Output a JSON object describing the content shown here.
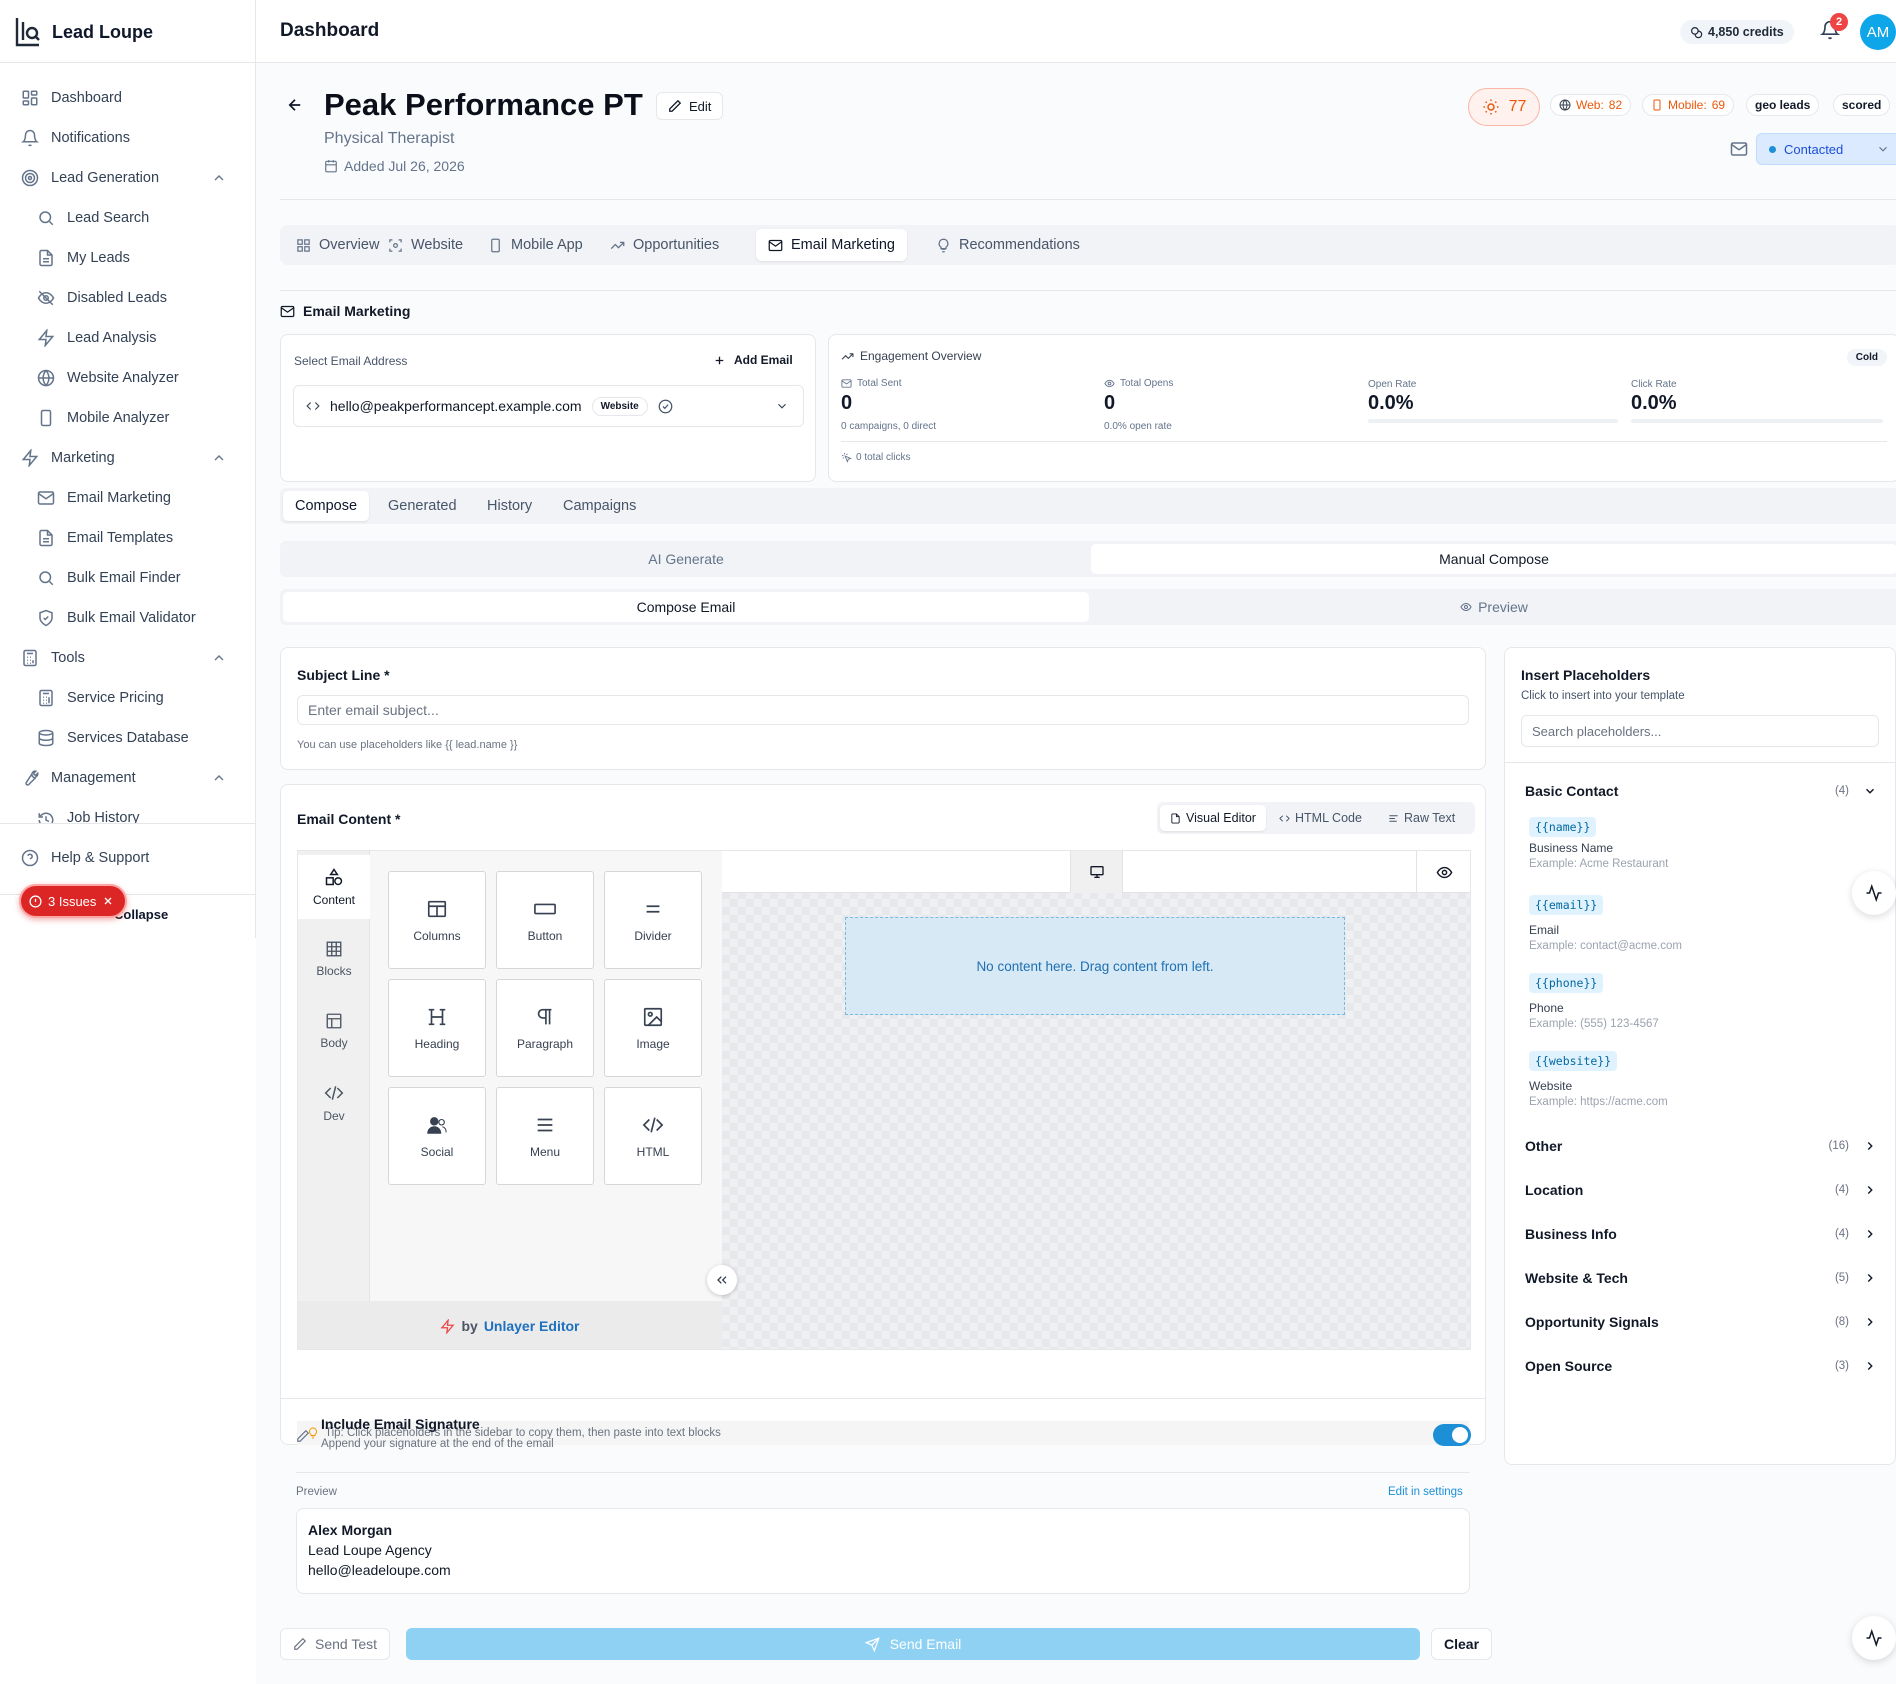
{
  "brand": {
    "name": "Lead Loupe"
  },
  "sidebar": {
    "items": [
      {
        "label": "Dashboard",
        "icon": "grid-icon"
      },
      {
        "label": "Notifications",
        "icon": "bell-icon"
      },
      {
        "label": "Lead Generation",
        "icon": "target-icon",
        "expanded": true
      },
      {
        "label": "Lead Search",
        "icon": "search-icon"
      },
      {
        "label": "My Leads",
        "icon": "file-icon"
      },
      {
        "label": "Disabled Leads",
        "icon": "eye-off-icon"
      },
      {
        "label": "Lead Analysis",
        "icon": "bolt-icon"
      },
      {
        "label": "Website Analyzer",
        "icon": "globe-icon"
      },
      {
        "label": "Mobile Analyzer",
        "icon": "phone-icon"
      },
      {
        "label": "Marketing",
        "icon": "bolt-icon",
        "expanded": true
      },
      {
        "label": "Email Marketing",
        "icon": "mail-icon"
      },
      {
        "label": "Email Templates",
        "icon": "file-icon"
      },
      {
        "label": "Bulk Email Finder",
        "icon": "search-icon"
      },
      {
        "label": "Bulk Email Validator",
        "icon": "shield-icon"
      },
      {
        "label": "Tools",
        "icon": "calculator-icon",
        "expanded": true
      },
      {
        "label": "Service Pricing",
        "icon": "calculator-icon"
      },
      {
        "label": "Services Database",
        "icon": "database-icon"
      },
      {
        "label": "Management",
        "icon": "wrench-icon",
        "expanded": true
      },
      {
        "label": "Job History",
        "icon": "history-icon"
      }
    ],
    "help": "Help & Support",
    "issues": "3 Issues",
    "collapse": "Collapse"
  },
  "header": {
    "title": "Dashboard",
    "credits": "4,850 credits",
    "notif_count": "2",
    "avatar": "AM"
  },
  "lead": {
    "name": "Peak Performance PT",
    "edit": "Edit",
    "category": "Physical Therapist",
    "added": "Added Jul 26, 2026",
    "score": "77",
    "web_label": "Web:",
    "web_score": "82",
    "mobile_label": "Mobile:",
    "mobile_score": "69",
    "tag1": "geo leads",
    "tag2": "scored",
    "status": "Contacted",
    "colors": {
      "accent": "#1d8fd6",
      "score": "#ea580c",
      "danger": "#dc2626"
    }
  },
  "tabs": [
    "Overview",
    "Website",
    "Mobile App",
    "Opportunities",
    "Email Marketing",
    "Recommendations"
  ],
  "email": {
    "section_title": "Email Marketing",
    "select_label": "Select Email Address",
    "add_email": "Add Email",
    "address": "hello@peakperformancept.example.com",
    "source": "Website"
  },
  "engagement": {
    "title": "Engagement Overview",
    "badge": "Cold",
    "total_sent_label": "Total Sent",
    "total_sent": "0",
    "total_sent_sub": "0 campaigns, 0 direct",
    "total_opens_label": "Total Opens",
    "total_opens": "0",
    "total_opens_sub": "0.0% open rate",
    "open_rate_label": "Open Rate",
    "open_rate": "0.0%",
    "click_rate_label": "Click Rate",
    "click_rate": "0.0%",
    "clicks": "0 total clicks"
  },
  "subtabs": [
    "Compose",
    "Generated",
    "History",
    "Campaigns"
  ],
  "mode": {
    "ai": "AI Generate",
    "manual": "Manual Compose"
  },
  "view": {
    "compose": "Compose Email",
    "preview": "Preview"
  },
  "subject": {
    "label": "Subject Line *",
    "placeholder": "Enter email subject...",
    "hint": "You can use placeholders like {{ lead.name }}"
  },
  "content": {
    "label": "Email Content *",
    "modes": [
      "Visual Editor",
      "HTML Code",
      "Raw Text"
    ],
    "side": [
      "Content",
      "Blocks",
      "Body",
      "Dev"
    ],
    "tiles": [
      "Columns",
      "Button",
      "Divider",
      "Heading",
      "Paragraph",
      "Image",
      "Social",
      "Menu",
      "HTML"
    ],
    "by": "by",
    "editor_brand": "Unlayer Editor",
    "drop": "No content here. Drag content from left.",
    "tip": "Tip: Click placeholders in the sidebar to copy them, then paste into text blocks"
  },
  "placeholders": {
    "title": "Insert Placeholders",
    "subtitle": "Click to insert into your template",
    "search_placeholder": "Search placeholders...",
    "basic": {
      "name": "Basic Contact",
      "count": "(4)"
    },
    "items": [
      {
        "code": "{{name}}",
        "label": "Business Name",
        "example": "Example: Acme Restaurant"
      },
      {
        "code": "{{email}}",
        "label": "Email",
        "example": "Example: contact@acme.com"
      },
      {
        "code": "{{phone}}",
        "label": "Phone",
        "example": "Example: (555) 123-4567"
      },
      {
        "code": "{{website}}",
        "label": "Website",
        "example": "Example: https://acme.com"
      }
    ],
    "categories": [
      {
        "name": "Other",
        "count": "(16)"
      },
      {
        "name": "Location",
        "count": "(4)"
      },
      {
        "name": "Business Info",
        "count": "(4)"
      },
      {
        "name": "Website & Tech",
        "count": "(5)"
      },
      {
        "name": "Opportunity Signals",
        "count": "(8)"
      },
      {
        "name": "Open Source",
        "count": "(3)"
      }
    ]
  },
  "signature": {
    "title": "Include Email Signature",
    "subtitle": "Append your signature at the end of the email",
    "enabled": true,
    "preview_label": "Preview",
    "edit_link": "Edit in settings",
    "name": "Alex Morgan",
    "company": "Lead Loupe Agency",
    "email": "hello@leadeloupe.com"
  },
  "actions": {
    "send_test": "Send Test",
    "send": "Send Email",
    "clear": "Clear"
  }
}
